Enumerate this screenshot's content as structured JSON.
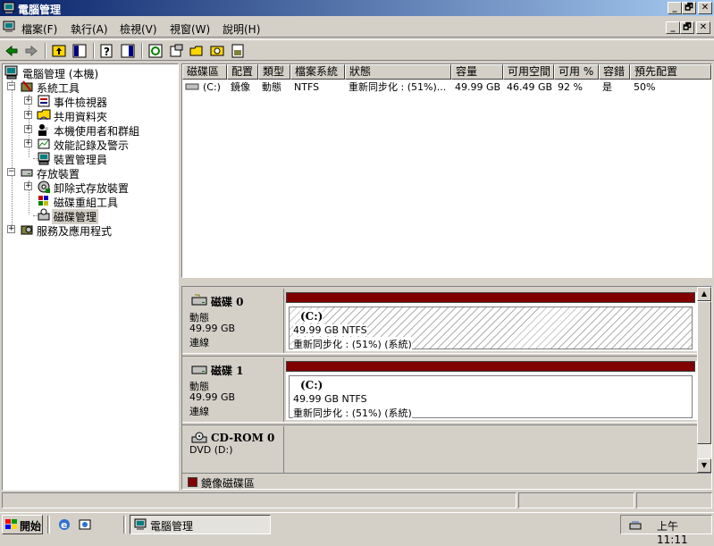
{
  "window": {
    "title": "電腦管理"
  },
  "caption_buttons": [
    "_",
    "🗗",
    "✕"
  ],
  "menu": [
    {
      "label": "檔案(F)"
    },
    {
      "label": "執行(A)"
    },
    {
      "label": "檢視(V)"
    },
    {
      "label": "視窗(W)"
    },
    {
      "label": "說明(H)"
    }
  ],
  "toolbar": {
    "icons": [
      "back-arrow-icon",
      "forward-arrow-icon",
      "up-folder-icon",
      "show-hide-tree-icon",
      "help-icon",
      "console-icon",
      "refresh-icon",
      "properties-icon",
      "open-icon",
      "search-icon",
      "export-icon"
    ]
  },
  "tree": {
    "root": "電腦管理 (本機)",
    "system_tools": "系統工具",
    "event_viewer": "事件檢視器",
    "shared_folders": "共用資料夾",
    "local_users": "本機使用者和群組",
    "perf_logs": "效能記錄及警示",
    "device_manager": "裝置管理員",
    "storage": "存放裝置",
    "removable": "卸除式存放裝置",
    "defrag": "磁碟重組工具",
    "disk_mgmt": "磁碟管理",
    "services": "服務及應用程式"
  },
  "volume_list": {
    "headers": [
      "磁碟區",
      "配置",
      "類型",
      "檔案系統",
      "狀態",
      "容量",
      "可用空間",
      "可用 %",
      "容錯",
      "預先配置"
    ],
    "rows": [
      [
        "(C:)",
        "鏡像",
        "動態",
        "NTFS",
        "重新同步化 : (51%)...",
        "49.99 GB",
        "46.49 GB",
        "92 %",
        "是",
        "50%"
      ]
    ]
  },
  "disks": [
    {
      "name": "磁碟 0",
      "type": "動態",
      "size": "49.99 GB",
      "status": "連線",
      "partition": {
        "label": "(C:)",
        "size": "49.99 GB NTFS",
        "state": "重新同步化 : (51%) (系統)"
      }
    },
    {
      "name": "磁碟 1",
      "type": "動態",
      "size": "49.99 GB",
      "status": "連線",
      "partition": {
        "label": "(C:)",
        "size": "49.99 GB NTFS",
        "state": "重新同步化 : (51%) (系統)"
      }
    },
    {
      "name": "CD-ROM 0",
      "type": "DVD (D:)"
    }
  ],
  "legend": {
    "label": "鏡像磁碟區",
    "color": "#800000"
  },
  "taskbar": {
    "start": "開始",
    "task": "電腦管理",
    "clock": "上午 11:11"
  }
}
